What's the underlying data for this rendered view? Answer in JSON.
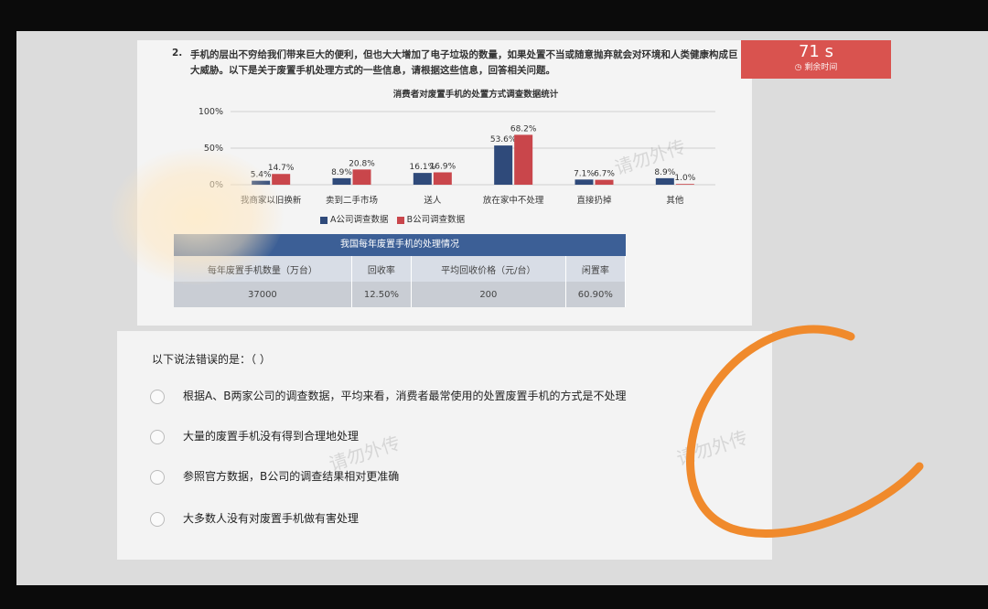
{
  "timer": {
    "seconds": "71 s",
    "label": "剩余时间"
  },
  "question": {
    "number": "2.",
    "text": "手机的层出不穷给我们带来巨大的便利，但也大大增加了电子垃圾的数量，如果处置不当或随意抛弃就会对环境和人类健康构成巨大威胁。以下是关于废置手机处理方式的一些信息，请根据这些信息，回答相关问题。"
  },
  "chart_data": {
    "type": "bar",
    "title": "消费者对废置手机的处置方式调查数据统计",
    "categories": [
      "我商家以旧换新",
      "卖到二手市场",
      "送人",
      "放在家中不处理",
      "直接扔掉",
      "其他"
    ],
    "series": [
      {
        "name": "A公司调查数据",
        "values": [
          5.4,
          8.9,
          16.1,
          53.6,
          7.1,
          8.9
        ],
        "labels": [
          "5.4%",
          "8.9%",
          "16.1%",
          "53.6%",
          "7.1%",
          "8.9%"
        ],
        "color": "#2f4a7a"
      },
      {
        "name": "B公司调查数据",
        "values": [
          14.7,
          20.8,
          16.9,
          68.2,
          6.7,
          1.0
        ],
        "labels": [
          "14.7%",
          "20.8%",
          "16.9%",
          "68.2%",
          "6.7%",
          "1.0%"
        ],
        "color": "#c9464b"
      }
    ],
    "yticks": [
      "100%",
      "50%",
      "0%"
    ],
    "ylim": [
      0,
      100
    ],
    "grid": true,
    "legend": "bottom"
  },
  "table": {
    "caption": "我国每年废置手机的处理情况",
    "headers": [
      "每年废置手机数量（万台）",
      "回收率",
      "平均回收价格（元/台）",
      "闲置率"
    ],
    "row": [
      "37000",
      "12.50%",
      "200",
      "60.90%"
    ]
  },
  "answer": {
    "stem": "以下说法错误的是：（ ）",
    "options": [
      "根据A、B两家公司的调查数据，平均来看，消费者最常使用的处置废置手机的方式是不处理",
      "大量的废置手机没有得到合理地处理",
      "参照官方数据，B公司的调查结果相对更准确",
      "大多数人没有对废置手机做有害处理"
    ]
  },
  "watermark": {
    "text": "请勿外传"
  },
  "colors": {
    "accent": "#d9534f",
    "table_header": "#3c5f96",
    "scribble": "#f08a2c"
  }
}
